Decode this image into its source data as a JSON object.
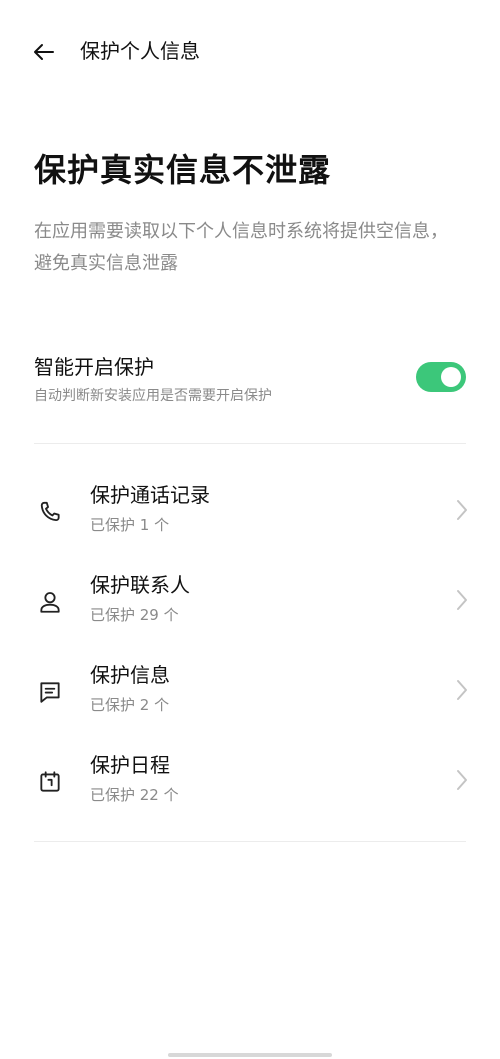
{
  "header": {
    "title": "保护个人信息",
    "back_icon": "arrow-left-icon"
  },
  "hero": {
    "title": "保护真实信息不泄露",
    "description": "在应用需要读取以下个人信息时系统将提供空信息，避免真实信息泄露"
  },
  "smart_protect": {
    "title": "智能开启保护",
    "subtitle": "自动判断新安装应用是否需要开启保护",
    "enabled": true,
    "accent_color": "#3cc77a"
  },
  "items": [
    {
      "title": "保护通话记录",
      "subtitle": "已保护 1 个",
      "icon": "phone-icon"
    },
    {
      "title": "保护联系人",
      "subtitle": "已保护 29 个",
      "icon": "contact-icon"
    },
    {
      "title": "保护信息",
      "subtitle": "已保护 2 个",
      "icon": "message-icon"
    },
    {
      "title": "保护日程",
      "subtitle": "已保护 22 个",
      "icon": "calendar-icon"
    }
  ]
}
